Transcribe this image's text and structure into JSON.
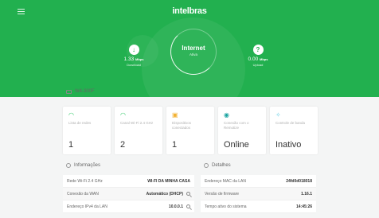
{
  "header": {
    "brand": "intelbras",
    "internet_title": "Internet",
    "internet_status": "Ativa",
    "download_value": "1.33",
    "download_unit": "Mbps",
    "download_label": "Download",
    "upload_value": "0.00",
    "upload_unit": "Mbps",
    "upload_label": "Upload"
  },
  "device": {
    "model": "W4-300F"
  },
  "cards": [
    {
      "icon": "wifi-icon",
      "label": "Lista de redes",
      "value": "1",
      "color": "#2ec866"
    },
    {
      "icon": "wifi-icon",
      "label": "Canal Wi-Fi 2.4 GHz",
      "value": "2",
      "color": "#2ec866"
    },
    {
      "icon": "devices-icon",
      "label": "Dispositivos conectados",
      "value": "1",
      "color": "#f2b233"
    },
    {
      "icon": "remotize-icon",
      "label": "Conexão com o Remotize",
      "value": "Online",
      "color": "#1aa3a0"
    },
    {
      "icon": "band-control-icon",
      "label": "Controle de banda",
      "value": "Inativo",
      "color": "#6fd1e8"
    }
  ],
  "info": {
    "title": "Informações",
    "rows": [
      {
        "label": "Rede Wi-Fi 2.4 GHz",
        "value": "WI-FI DA MINHA CASA"
      },
      {
        "label": "Conexão da WAN",
        "value": "Automático (DHCP)"
      },
      {
        "label": "Endereço IPv4 da LAN",
        "value": "10.0.0.1"
      }
    ]
  },
  "details": {
    "title": "Detalhes",
    "rows": [
      {
        "label": "Endereço MAC da LAN",
        "value": "24fd0d018018"
      },
      {
        "label": "Versão de firmware",
        "value": "1.16.1"
      },
      {
        "label": "Tempo ativo do sistema",
        "value": "14:45:26"
      }
    ]
  }
}
